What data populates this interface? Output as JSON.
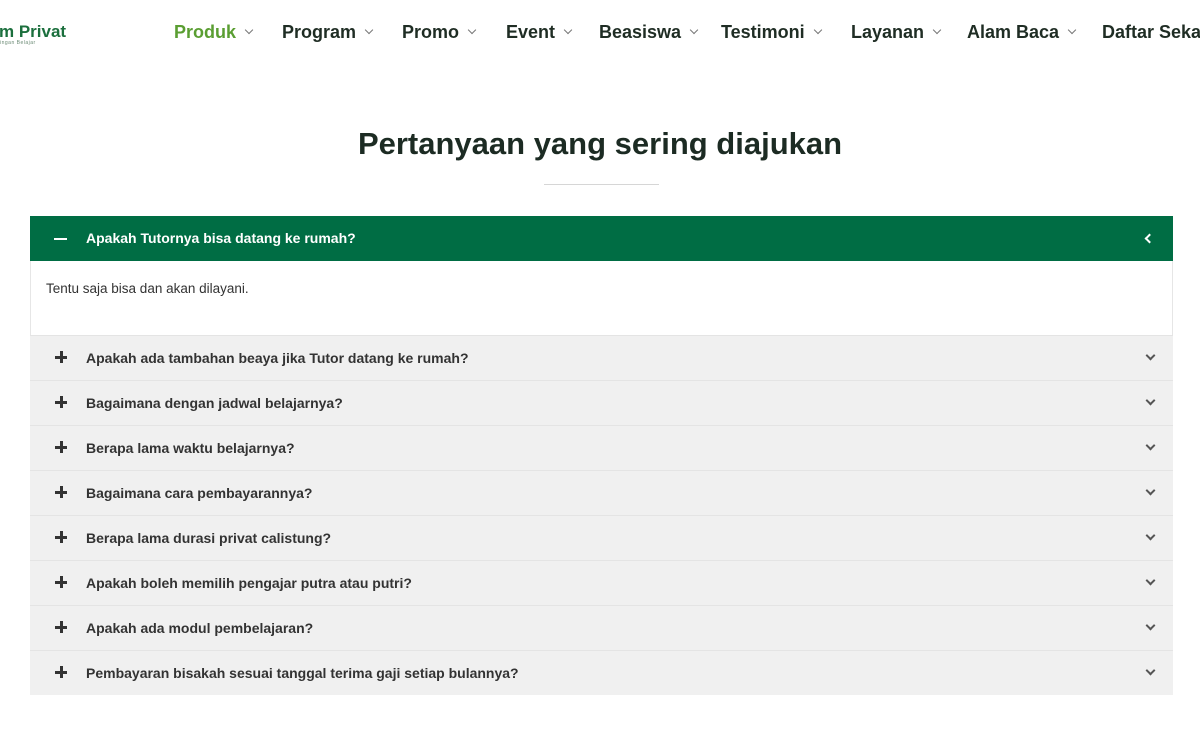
{
  "brand": {
    "name": "m Privat",
    "tagline": "ingan Belajar"
  },
  "nav": {
    "items": [
      {
        "label": "Produk",
        "active": true
      },
      {
        "label": "Program",
        "active": false
      },
      {
        "label": "Promo",
        "active": false
      },
      {
        "label": "Event",
        "active": false
      },
      {
        "label": "Beasiswa",
        "active": false
      },
      {
        "label": "Testimoni",
        "active": false
      },
      {
        "label": "Layanan",
        "active": false
      },
      {
        "label": "Alam Baca",
        "active": false
      },
      {
        "label": "Daftar Seka",
        "active": false
      }
    ]
  },
  "faq": {
    "title": "Pertanyaan yang sering diajukan",
    "open_item": {
      "question": "Apakah Tutornya bisa datang ke rumah?",
      "answer": "Tentu saja bisa dan akan dilayani."
    },
    "items": [
      {
        "question": "Apakah ada tambahan beaya jika Tutor datang ke rumah?"
      },
      {
        "question": "Bagaimana dengan jadwal belajarnya?"
      },
      {
        "question": "Berapa lama waktu belajarnya?"
      },
      {
        "question": "Bagaimana cara pembayarannya?"
      },
      {
        "question": "Berapa lama durasi privat calistung?"
      },
      {
        "question": "Apakah boleh memilih pengajar putra atau putri?"
      },
      {
        "question": "Apakah ada modul pembelajaran?"
      },
      {
        "question": "Pembayaran bisakah sesuai tanggal terima gaji setiap bulannya?"
      }
    ]
  },
  "colors": {
    "accent_green": "#006d44",
    "active_nav": "#5a9e32",
    "brand_green": "#1b6f3d",
    "item_bg": "#f0f0f0"
  },
  "icons": {
    "nav_caret": "chevron-down-icon",
    "open_toggle": "minus-icon",
    "closed_toggle": "plus-icon",
    "open_chevron": "chevron-left-icon",
    "closed_chevron": "chevron-down-icon"
  }
}
